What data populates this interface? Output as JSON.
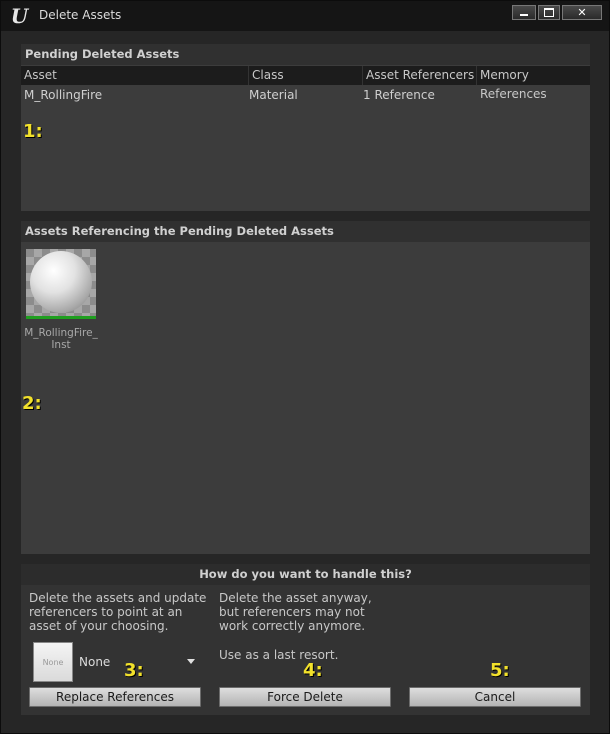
{
  "window": {
    "title": "Delete Assets",
    "logo_glyph": "U",
    "close_glyph": "✕"
  },
  "pending": {
    "header": "Pending Deleted Assets",
    "columns": [
      "Asset",
      "Class",
      "Asset Referencers",
      "Memory References"
    ],
    "rows": [
      {
        "asset": "M_RollingFire",
        "class": "Material",
        "referencers": "1 Reference",
        "memory": ""
      }
    ]
  },
  "referencing": {
    "header": "Assets Referencing the Pending Deleted Assets",
    "items": [
      {
        "label_line1": "M_RollingFire_",
        "label_line2": "Inst"
      }
    ]
  },
  "handle": {
    "title": "How do you want to handle this?",
    "replace_desc": "Delete the assets and update referencers to point at an asset of your choosing.",
    "force_desc": "Delete the asset anyway, but referencers may not work correctly anymore.",
    "force_note": "Use as a last resort.",
    "picker_thumb_text": "None",
    "picker_value": "None",
    "replace_button": "Replace References",
    "force_button": "Force Delete",
    "cancel_button": "Cancel"
  },
  "annotations": [
    "1:",
    "2:",
    "3:",
    "4:",
    "5:"
  ],
  "colors": {
    "annotation": "#f2e12b",
    "thumbnail_underline": "#1f9f1f"
  }
}
